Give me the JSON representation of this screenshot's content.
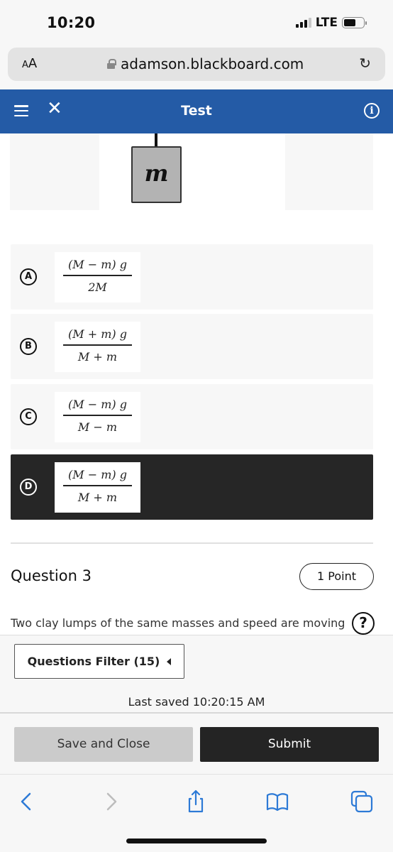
{
  "status_bar": {
    "time": "10:20",
    "network": "LTE",
    "signal_bars_active": 3,
    "signal_bars_total": 4,
    "battery_level": 0.6
  },
  "browser": {
    "text_size_label": "AA",
    "url": "adamson.blackboard.com",
    "reload_icon": "reload-icon",
    "lock_icon": "lock-icon"
  },
  "header": {
    "title": "Test",
    "menu_icon": "hamburger-icon",
    "close_icon": "close-icon",
    "info_icon": "info-icon",
    "bg_color": "#245ba6"
  },
  "figure": {
    "mass_label": "m"
  },
  "options": [
    {
      "letter": "A",
      "numerator": "(M − m) g",
      "denominator": "2M",
      "selected": false
    },
    {
      "letter": "B",
      "numerator": "(M + m) g",
      "denominator": "M + m",
      "selected": false
    },
    {
      "letter": "C",
      "numerator": "(M − m) g",
      "denominator": "M − m",
      "selected": false
    },
    {
      "letter": "D",
      "numerator": "(M − m) g",
      "denominator": "M + m",
      "selected": true
    }
  ],
  "question": {
    "title": "Question 3",
    "points": "1 Point",
    "text": "Two clay lumps of the same masses and speed are moving",
    "help_icon": "help-bubble-icon"
  },
  "footer": {
    "filter_label": "Questions Filter (15)",
    "last_saved": "Last saved 10:20:15 AM",
    "save_close_label": "Save and Close",
    "submit_label": "Submit"
  },
  "toolbar": {
    "items": [
      "back",
      "forward",
      "share",
      "bookmarks",
      "tabs"
    ],
    "accent_color": "#2d7ad6"
  }
}
